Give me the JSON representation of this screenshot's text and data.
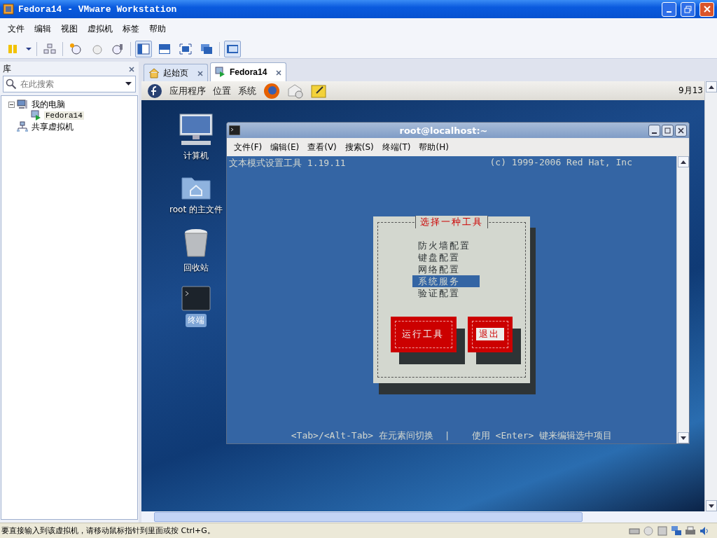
{
  "window": {
    "title": "Fedora14 - VMware Workstation"
  },
  "menu": [
    "文件",
    "编辑",
    "视图",
    "虚拟机",
    "标签",
    "帮助"
  ],
  "library": {
    "title": "库",
    "search": {
      "placeholder": "在此搜索"
    },
    "tree": [
      {
        "label": "我的电脑",
        "expanded": true,
        "kind": "computer",
        "children": [
          {
            "label": "Fedora14",
            "kind": "vm",
            "selected": true
          }
        ]
      },
      {
        "label": "共享虚拟机",
        "kind": "shared"
      }
    ]
  },
  "tabs": [
    {
      "label": "起始页",
      "kind": "home",
      "selected": false
    },
    {
      "label": "Fedora14",
      "kind": "vm",
      "selected": true
    }
  ],
  "guest": {
    "panel_menus": [
      "应用程序",
      "位置",
      "系统"
    ],
    "clock": "9月13",
    "desktop_icons": [
      {
        "label": "计算机",
        "kind": "computer",
        "selected": false
      },
      {
        "label": "root 的主文件",
        "kind": "home",
        "selected": false
      },
      {
        "label": "回收站",
        "kind": "trash",
        "selected": false
      },
      {
        "label": "终端",
        "kind": "terminal",
        "selected": true
      }
    ],
    "terminal": {
      "title": "root@localhost:~",
      "menu": [
        "文件(F)",
        "编辑(E)",
        "查看(V)",
        "搜索(S)",
        "终端(T)",
        "帮助(H)"
      ],
      "header_left": "文本模式设置工具 1.19.11",
      "header_right": "(c) 1999-2006 Red Hat, Inc",
      "dialog": {
        "title": "选择一种工具",
        "items": [
          {
            "label": "防火墙配置",
            "selected": false
          },
          {
            "label": "键盘配置",
            "selected": false
          },
          {
            "label": "网络配置",
            "selected": false
          },
          {
            "label": "系统服务",
            "selected": true
          },
          {
            "label": "验证配置",
            "selected": false
          }
        ],
        "buttons": [
          {
            "label": "运行工具",
            "selected": false
          },
          {
            "label": "退出",
            "selected": true
          }
        ]
      },
      "footer": "<Tab>/<Alt-Tab> 在元素间切换  |    使用 <Enter> 键来编辑选中项目"
    }
  },
  "status_bar": {
    "text": "要直接输入到该虚拟机，请移动鼠标指针到里面或按 Ctrl+G。"
  }
}
